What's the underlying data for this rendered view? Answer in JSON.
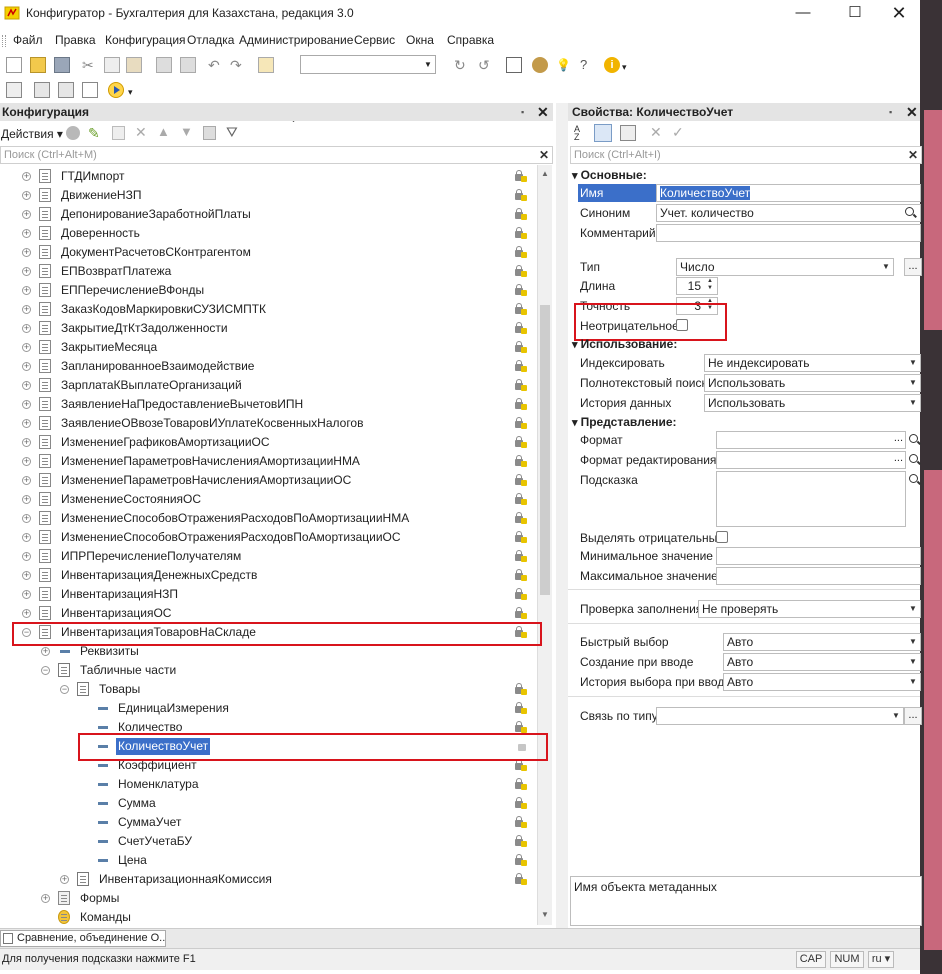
{
  "window": {
    "title": "Конфигуратор - Бухгалтерия для Казахстана, редакция 3.0"
  },
  "menu": [
    "Файл",
    "Правка",
    "Конфигурация",
    "Отладка",
    "Администрирование",
    "Сервис",
    "Окна",
    "Справка"
  ],
  "left_panel": {
    "title": "Конфигурация",
    "actions_label": "Действия",
    "search_placeholder": "Поиск (Ctrl+Alt+M)",
    "tree": [
      {
        "label": "ГТДИмпорт"
      },
      {
        "label": "ДвижениеНЗП"
      },
      {
        "label": "ДепонированиеЗаработнойПлаты"
      },
      {
        "label": "Доверенность"
      },
      {
        "label": "ДокументРасчетовСКонтрагентом"
      },
      {
        "label": "ЕПВозвратПлатежа"
      },
      {
        "label": "ЕППеречислениеВФонды"
      },
      {
        "label": "ЗаказКодовМаркировкиСУЗИСМПТК"
      },
      {
        "label": "ЗакрытиеДтКтЗадолженности"
      },
      {
        "label": "ЗакрытиеМесяца"
      },
      {
        "label": "ЗапланированноеВзаимодействие"
      },
      {
        "label": "ЗарплатаКВыплатеОрганизаций"
      },
      {
        "label": "ЗаявлениеНаПредоставлениеВычетовИПН"
      },
      {
        "label": "ЗаявлениеОВвозеТоваровИУплатеКосвенныхНалогов"
      },
      {
        "label": "ИзменениеГрафиковАмортизацииОС"
      },
      {
        "label": "ИзменениеПараметровНачисленияАмортизацииНМА"
      },
      {
        "label": "ИзменениеПараметровНачисленияАмортизацииОС"
      },
      {
        "label": "ИзменениеСостоянияОС"
      },
      {
        "label": "ИзменениеСпособовОтраженияРасходовПоАмортизацииНМА"
      },
      {
        "label": "ИзменениеСпособовОтраженияРасходовПоАмортизацииОС"
      },
      {
        "label": "ИПРПеречислениеПолучателям"
      },
      {
        "label": "ИнвентаризацияДенежныхСредств"
      },
      {
        "label": "ИнвентаризацияНЗП"
      },
      {
        "label": "ИнвентаризацияОС"
      },
      {
        "label": "ИнвентаризацияТоваровНаСкладе"
      },
      {
        "label": "Реквизиты"
      },
      {
        "label": "Табличные части"
      },
      {
        "label": "Товары"
      },
      {
        "label": "ЕдиницаИзмерения"
      },
      {
        "label": "Количество"
      },
      {
        "label": "КоличествоУчет"
      },
      {
        "label": "Коэффициент"
      },
      {
        "label": "Номенклатура"
      },
      {
        "label": "Сумма"
      },
      {
        "label": "СуммаУчет"
      },
      {
        "label": "СчетУчетаБУ"
      },
      {
        "label": "Цена"
      },
      {
        "label": "ИнвентаризационнаяКомиссия"
      },
      {
        "label": "Формы"
      },
      {
        "label": "Команды"
      }
    ]
  },
  "right_panel": {
    "title": "Свойства: КоличествоУчет",
    "search_placeholder": "Поиск (Ctrl+Alt+I)",
    "sections": {
      "basic": "Основные:",
      "usage": "Использование:",
      "presentation": "Представление:"
    },
    "props": {
      "name_label": "Имя",
      "name_value": "КоличествоУчет",
      "synonym_label": "Синоним",
      "synonym_value": "Учет. количество",
      "comment_label": "Комментарий",
      "type_label": "Тип",
      "type_value": "Число",
      "length_label": "Длина",
      "length_value": "15",
      "precision_label": "Точность",
      "precision_value": "3",
      "nonneg_label": "Неотрицательное",
      "index_label": "Индексировать",
      "index_value": "Не индексировать",
      "fulltext_label": "Полнотекстовый поиск",
      "fulltext_value": "Использовать",
      "history_label": "История данных",
      "history_value": "Использовать",
      "format_label": "Формат",
      "editformat_label": "Формат редактирования",
      "hint_label": "Подсказка",
      "highlight_neg_label": "Выделять отрицательные",
      "min_label": "Минимальное значение",
      "max_label": "Максимальное значение",
      "fillcheck_label": "Проверка заполнения",
      "fillcheck_value": "Не проверять",
      "quickchoice_label": "Быстрый выбор",
      "quickchoice_value": "Авто",
      "createoninput_label": "Создание при вводе",
      "createoninput_value": "Авто",
      "choicehistory_label": "История выбора при вводе",
      "choicehistory_value": "Авто",
      "linkbytype_label": "Связь по типу"
    },
    "description": "Имя объекта метаданных"
  },
  "taskbar": {
    "item": "Сравнение, объединение О..."
  },
  "status": {
    "hint": "Для получения подсказки нажмите F1",
    "cap": "CAP",
    "num": "NUM",
    "lang": "ru ▾"
  },
  "colors": {
    "selection": "#3b6fc9",
    "red_highlight": "#d8141c"
  }
}
